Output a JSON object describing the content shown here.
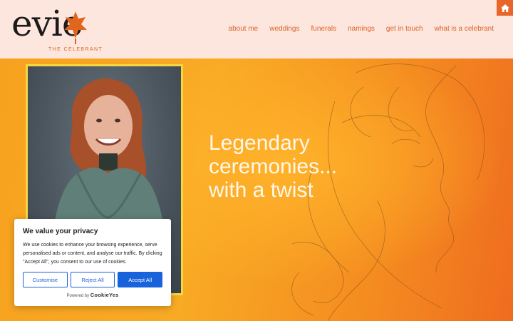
{
  "logo": {
    "word": "evie",
    "tagline": "THE CELEBRANT"
  },
  "nav": {
    "items": [
      {
        "label": "about me"
      },
      {
        "label": "weddings"
      },
      {
        "label": "funerals"
      },
      {
        "label": "namings"
      },
      {
        "label": "get in touch"
      },
      {
        "label": "what is a celebrant"
      }
    ]
  },
  "home_icon": "home-icon",
  "hero": {
    "line1": "Legendary",
    "line2": "ceremonies...",
    "line3": "with a twist"
  },
  "cookie": {
    "title": "We value your privacy",
    "text": "We use cookies to enhance your browsing experience, serve personalised ads or content, and analyse our traffic. By clicking \"Accept All\", you consent to our use of cookies.",
    "customise": "Customise",
    "reject": "Reject All",
    "accept": "Accept All",
    "powered_prefix": "Powered by",
    "powered_brand": "CookieYes"
  },
  "colors": {
    "accent": "#d9642a",
    "header_bg": "#fde6dd",
    "cookie_blue": "#1863dc",
    "frame": "#f5d742"
  }
}
